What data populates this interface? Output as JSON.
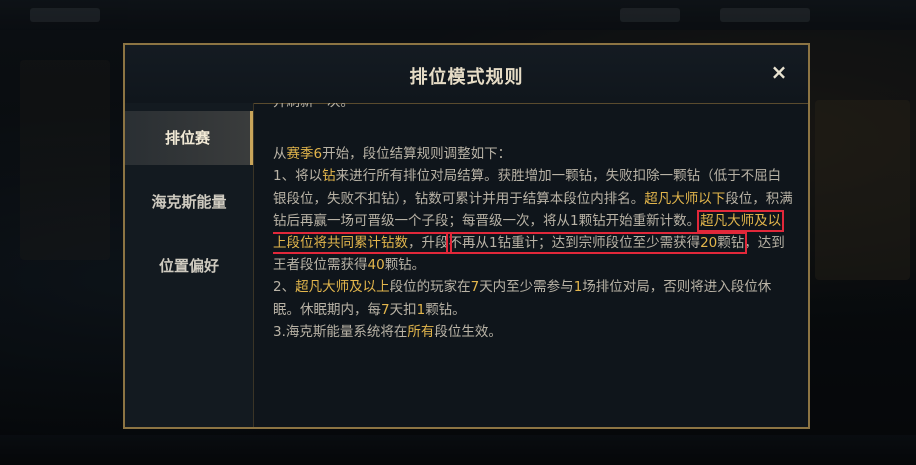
{
  "modal": {
    "title": "排位模式规则",
    "close": "×"
  },
  "sidebar": {
    "items": [
      {
        "label": "排位赛",
        "active": true
      },
      {
        "label": "海克斯能量",
        "active": false
      },
      {
        "label": "位置偏好",
        "active": false
      }
    ]
  },
  "content": {
    "top_fragment": "并刷新一次。",
    "intro": {
      "a": "从",
      "season": "赛季6",
      "b": "开始，段位结算规则调整如下："
    },
    "rule1": {
      "a": "1、将以",
      "k1": "钻",
      "b": "来进行所有排位对局结算。获胜增加一颗钻，失败扣除一颗钻（低于不屈白银段位，失败不扣钻），钻数可累计并用于结算本段位内排名。",
      "k2": "超凡大师以下",
      "c": "段位，积满钻后再赢一场可晋级一个子段；每晋级一次，将从1颗钻开始重新计数。",
      "hl1_gold": "超凡大师及以上",
      "hl1_text": "段位将共同累计钻数",
      "d": "，升段",
      "hl2_text": "不再从1钻重计；达到宗师段位至少需获得",
      "hl2_num": "20",
      "hl2_unit": "颗钻",
      "e": "，达到王者段位需获得",
      "num40": "40",
      "f": "颗钻。"
    },
    "rule2": {
      "a": "2、",
      "k1": "超凡大师及以上",
      "b": "段位的玩家在",
      "k2": "7",
      "c": "天内至少需参与",
      "k3": "1",
      "d": "场排位对局，否则将进入段位休眠。休眠期内，每",
      "k4": "7",
      "e": "天扣",
      "k5": "1",
      "f": "颗钻。"
    },
    "rule3": {
      "a": "3.海克斯能量系统将在",
      "k1": "所有",
      "b": "段位生效。"
    }
  },
  "colors": {
    "accent_gold": "#e3b64c",
    "frame": "#8c7443",
    "highlight_red": "#e1283a"
  }
}
